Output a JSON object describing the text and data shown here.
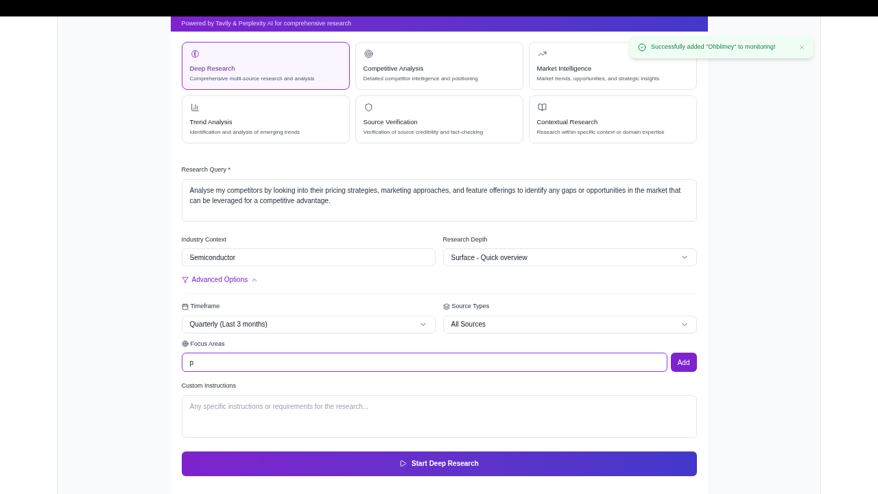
{
  "header": {
    "subtitle": "Powered by Tavily & Perplexity AI for comprehensive research"
  },
  "research_types": [
    {
      "kind": "brain",
      "title": "Deep Research",
      "description": "Comprehensive multi-source research and analysis",
      "selected": true
    },
    {
      "kind": "target",
      "title": "Competitive Analysis",
      "description": "Detailed competitor intelligence and positioning",
      "selected": false
    },
    {
      "kind": "trend",
      "title": "Market Intelligence",
      "description": "Market trends, opportunities, and strategic insights",
      "selected": false
    },
    {
      "kind": "chart",
      "title": "Trend Analysis",
      "description": "Identification and analysis of emerging trends",
      "selected": false
    },
    {
      "kind": "shield",
      "title": "Source Verification",
      "description": "Verification of source credibility and fact-checking",
      "selected": false
    },
    {
      "kind": "book",
      "title": "Contextual Research",
      "description": "Research within specific context or domain expertise",
      "selected": false
    }
  ],
  "query": {
    "label": "Research Query *",
    "value": "Analyse my competitors by looking into their pricing strategies, marketing approaches, and feature offerings to identify any gaps or opportunities in the market that can be leveraged for a competitive advantage."
  },
  "industry": {
    "label": "Industry Context",
    "value": "Semiconductor"
  },
  "depth": {
    "label": "Research Depth",
    "value": "Surface - Quick overview"
  },
  "advanced": {
    "label": "Advanced Options",
    "expanded": true
  },
  "timeframe": {
    "label": "Timeframe",
    "value": "Quarterly (Last 3 months)"
  },
  "source_types": {
    "label": "Source Types",
    "value": "All Sources"
  },
  "focus_areas": {
    "label": "Focus Areas",
    "value": "p",
    "button": "Add"
  },
  "custom": {
    "label": "Custom Instructions",
    "placeholder": "Any specific instructions or requirements for the research..."
  },
  "start_button": "Start Deep Research",
  "toast": {
    "message": "Successfully added \"Ohblimey\" to monitoring!"
  }
}
